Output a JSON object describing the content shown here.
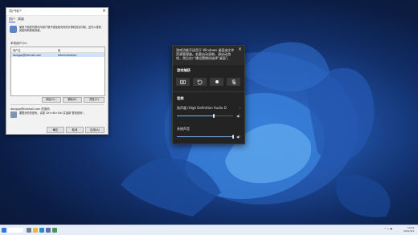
{
  "desktop": {
    "accent": "#2d67c4"
  },
  "user_window": {
    "title": "用户帐户",
    "tabs": [
      "用户",
      "高级"
    ],
    "description": "使用下面的列表可向用户授予或拒绝对你的计算机的访问权，还可以更改其密码和其他设置。",
    "list_label": "本机用户(U):",
    "columns": [
      "用户名",
      "组"
    ],
    "rows": [
      {
        "user": "dongpp@hotmail.com",
        "group": "Administrators"
      }
    ],
    "list_buttons": [
      "添加(D)...",
      "删除(R)",
      "属性(O)"
    ],
    "password_group_title": "dongpp@hotmail.com 的密码",
    "password_text": "要更改你的密码，请按 Ctrl+Alt+Del 并选择\"更改密码\"。",
    "buttons": [
      "确定",
      "取消",
      "应用(A)"
    ]
  },
  "game_bar": {
    "warning": "游戏功能不适用于 Windows 桌面或文件资源管理器。若要启动录制，请启动游戏，然后在广播设置期间选择\"桌面\"。",
    "capture_title": "游戏捕获",
    "capture_icons": [
      "camera-icon",
      "replay-icon",
      "record-icon",
      "mic-icon"
    ],
    "audio_title": "音频",
    "device": "扬声器 (High Definition Audio D",
    "device_volume": 0.66,
    "app_name": "系统声音",
    "app_volume": 1.0
  },
  "taskbar": {
    "time": "10:21",
    "date": "2021/9/1"
  }
}
